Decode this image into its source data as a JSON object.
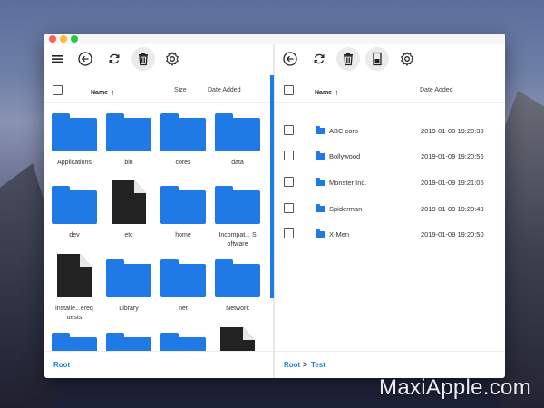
{
  "watermark": "MaxiApple.com",
  "colors": {
    "accent": "#1f7ae6",
    "file": "#222222"
  },
  "left_pane": {
    "toolbar": [
      "menu-icon",
      "back-icon",
      "refresh-icon",
      "trash-icon",
      "settings-icon"
    ],
    "header": {
      "name": "Name",
      "size": "Size",
      "date": "Date Added"
    },
    "items": [
      {
        "label": "Applications",
        "kind": "folder"
      },
      {
        "label": "bin",
        "kind": "folder"
      },
      {
        "label": "cores",
        "kind": "folder"
      },
      {
        "label": "data",
        "kind": "folder"
      },
      {
        "label": "dev",
        "kind": "folder"
      },
      {
        "label": "etc",
        "kind": "file"
      },
      {
        "label": "home",
        "kind": "folder"
      },
      {
        "label": "Incompat... S oftware",
        "kind": "folder"
      },
      {
        "label": "installe...ereq uests",
        "kind": "file"
      },
      {
        "label": "Library",
        "kind": "folder"
      },
      {
        "label": "net",
        "kind": "folder"
      },
      {
        "label": "Network",
        "kind": "folder"
      },
      {
        "label": "",
        "kind": "folder"
      },
      {
        "label": "",
        "kind": "folder"
      },
      {
        "label": "",
        "kind": "folder"
      },
      {
        "label": "",
        "kind": "file"
      }
    ],
    "breadcrumb": [
      "Root"
    ]
  },
  "right_pane": {
    "toolbar": [
      "back-icon",
      "refresh-icon",
      "trash-icon",
      "sd-card-icon",
      "settings-icon"
    ],
    "header": {
      "name": "Name",
      "date": "Date Added"
    },
    "rows": [
      {
        "name": "ABC corp",
        "date": "2019-01-09 19:20:38"
      },
      {
        "name": "Bollywood",
        "date": "2019-01-09 19:20:56"
      },
      {
        "name": "Monster Inc.",
        "date": "2019-01-09 19:21:06"
      },
      {
        "name": "Spiderman",
        "date": "2019-01-09 19:20:43"
      },
      {
        "name": "X-Men",
        "date": "2019-01-09 19:20:50"
      }
    ],
    "breadcrumb": [
      "Root",
      "Test"
    ],
    "breadcrumb_separator": ">"
  }
}
